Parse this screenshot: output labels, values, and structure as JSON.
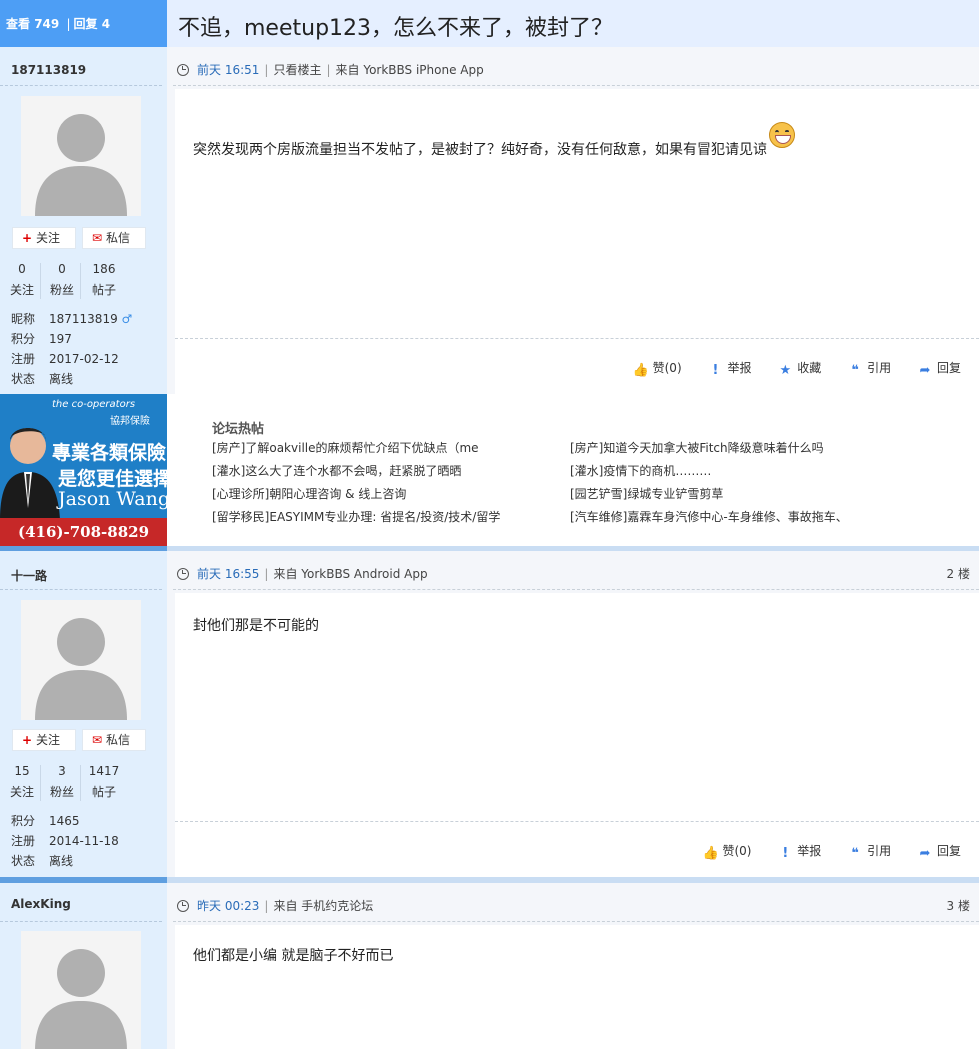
{
  "header": {
    "views_label": "查看",
    "views": "749",
    "replies_label": "回复",
    "replies": "4",
    "title": "不追，meetup123，怎么不来了，被封了？"
  },
  "posts": [
    {
      "username": "187113819",
      "follow_label": "关注",
      "message_label": "私信",
      "stats": [
        {
          "num": "0",
          "label": "关注"
        },
        {
          "num": "0",
          "label": "粉丝"
        },
        {
          "num": "186",
          "label": "帖子"
        }
      ],
      "info": [
        {
          "k": "昵称",
          "v": "187113819"
        },
        {
          "k": "积分",
          "v": "197"
        },
        {
          "k": "注册",
          "v": "2017-02-12"
        },
        {
          "k": "状态",
          "v": "离线"
        }
      ],
      "time": "前天 16:51",
      "only_op": "只看楼主",
      "source": "来自 YorkBBS iPhone App",
      "floor": "",
      "content": "突然发现两个房版流量担当不发帖了，是被封了？纯好奇，没有任何敌意，如果有冒犯请见谅",
      "actions": [
        {
          "icon": "thumbs-up-icon",
          "label": "赞(0)"
        },
        {
          "icon": "exclamation-icon",
          "label": "举报"
        },
        {
          "icon": "star-icon",
          "label": "收藏"
        },
        {
          "icon": "quote-icon",
          "label": "引用"
        },
        {
          "icon": "reply-arrow-icon",
          "label": "回复"
        }
      ]
    },
    {
      "username": "十一路",
      "follow_label": "关注",
      "message_label": "私信",
      "stats": [
        {
          "num": "15",
          "label": "关注"
        },
        {
          "num": "3",
          "label": "粉丝"
        },
        {
          "num": "1417",
          "label": "帖子"
        }
      ],
      "info": [
        {
          "k": "积分",
          "v": "1465"
        },
        {
          "k": "注册",
          "v": "2014-11-18"
        },
        {
          "k": "状态",
          "v": "离线"
        }
      ],
      "time": "前天 16:55",
      "source": "来自 YorkBBS Android App",
      "floor": "2 楼",
      "content": "封他们那是不可能的",
      "actions": [
        {
          "icon": "thumbs-up-icon",
          "label": "赞(0)"
        },
        {
          "icon": "exclamation-icon",
          "label": "举报"
        },
        {
          "icon": "quote-icon",
          "label": "引用"
        },
        {
          "icon": "reply-arrow-icon",
          "label": "回复"
        }
      ]
    },
    {
      "username": "AlexKing",
      "time": "昨天 00:23",
      "source": "来自 手机约克论坛",
      "floor": "3 楼",
      "content": "他们都是小编 就是脑子不好而已"
    }
  ],
  "ad": {
    "brand": "the co-operators",
    "brand_cn": "協邦保險",
    "line1": "專業各類保險",
    "line2": "是您更佳選擇",
    "name": "Jason Wang",
    "phone": "(416)-708-8829"
  },
  "hot": {
    "title": "论坛热帖",
    "col1": [
      "[房产]了解oakville的麻烦帮忙介绍下优缺点（me",
      "[灌水]这么大了连个水都不会喝，赶紧脱了晒晒",
      "[心理诊所]朝阳心理咨询 & 线上咨询",
      "[留学移民]EASYIMM专业办理: 省提名/投资/技术/留学"
    ],
    "col2": [
      "[房产]知道今天加拿大被Fitch降级意味着什么吗",
      "[灌水]疫情下的商机………",
      "[园艺铲雪]绿城专业铲雪剪草",
      "[汽车维修]嘉霖车身汽修中心-车身维修、事故拖车、"
    ]
  },
  "colors": {
    "header_accent": "#4d9ef5",
    "sidebar_bg": "#e1effd",
    "time_link": "#2a6cb8",
    "action_icon": "#3a7ee0"
  }
}
